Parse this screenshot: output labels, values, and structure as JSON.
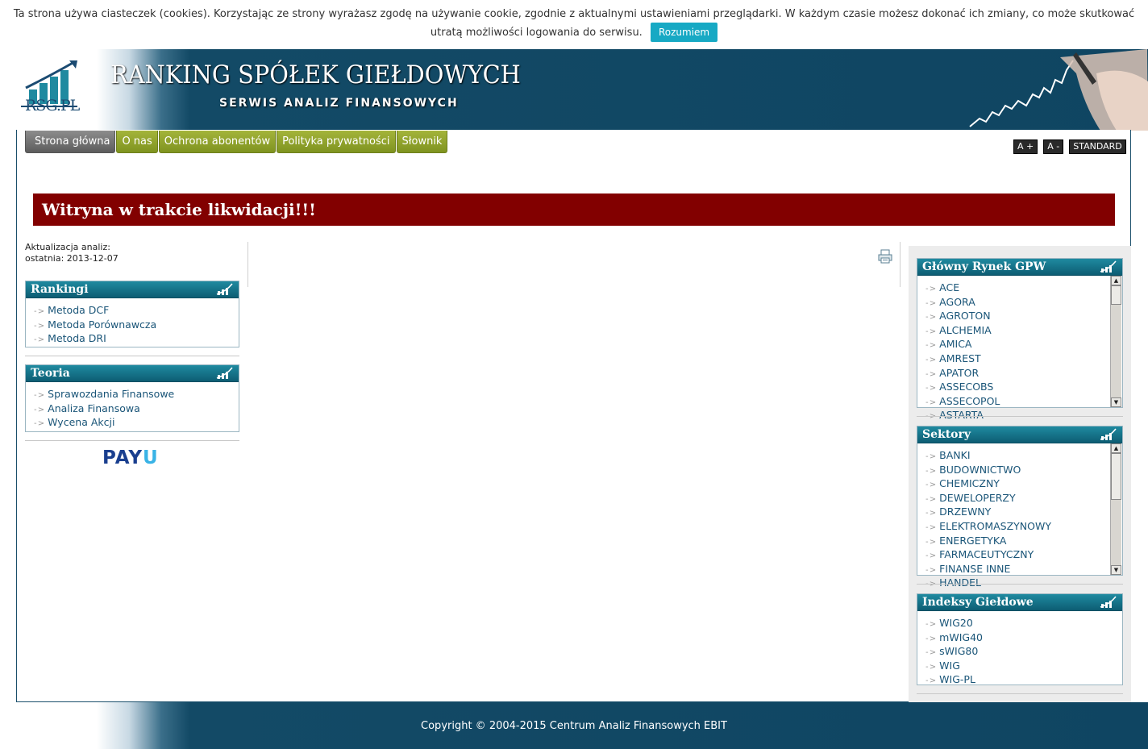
{
  "cookie": {
    "text": "Ta strona używa ciasteczek (cookies). Korzystając ze strony wyrażasz zgodę na używanie cookie, zgodnie z aktualnymi ustawieniami przeglądarki. W każdym czasie możesz dokonać ich zmiany, co może skutkować utratą możliwości logowania do serwisu.",
    "button": "Rozumiem"
  },
  "header": {
    "logo_text": "RSG.PL",
    "title": "RANKING SPÓŁEK GIEŁDOWYCH",
    "subtitle": "SERWIS ANALIZ FINANSOWYCH"
  },
  "nav": {
    "items": [
      {
        "label": "Strona główna"
      },
      {
        "label": "O nas"
      },
      {
        "label": "Ochrona abonentów"
      },
      {
        "label": "Polityka prywatności"
      },
      {
        "label": "Słownik"
      }
    ]
  },
  "font_controls": {
    "increase": "A +",
    "decrease": "A -",
    "standard": "STANDARD"
  },
  "banner": {
    "text": "Witryna w trakcie likwidacji!!!"
  },
  "update": {
    "line1": "Aktualizacja analiz:",
    "line2": "ostatnia: 2013-12-07"
  },
  "rankings": {
    "title": "Rankingi",
    "items": [
      "Metoda DCF",
      "Metoda Porównawcza",
      "Metoda DRI"
    ]
  },
  "theory": {
    "title": "Teoria",
    "items": [
      "Sprawozdania Finansowe",
      "Analiza Finansowa",
      "Wycena Akcji"
    ]
  },
  "payu": {
    "pay": "PAY",
    "u": "U"
  },
  "main_market": {
    "title": "Główny Rynek GPW",
    "items": [
      "ACE",
      "AGORA",
      "AGROTON",
      "ALCHEMIA",
      "AMICA",
      "AMREST",
      "APATOR",
      "ASSECOBS",
      "ASSECOPOL",
      "ASTARTA"
    ]
  },
  "sectors": {
    "title": "Sektory",
    "items": [
      "BANKI",
      "BUDOWNICTWO",
      "CHEMICZNY",
      "DEWELOPERZY",
      "DRZEWNY",
      "ELEKTROMASZYNOWY",
      "ENERGETYKA",
      "FARMACEUTYCZNY",
      "FINANSE INNE",
      "HANDEL"
    ]
  },
  "indices": {
    "title": "Indeksy Giełdowe",
    "items": [
      "WIG20",
      "mWIG40",
      "sWIG80",
      "WIG",
      "WIG-PL"
    ]
  },
  "footer": {
    "copyright": "Copyright © 2004-2015 Centrum Analiz Finansowych EBIT"
  }
}
